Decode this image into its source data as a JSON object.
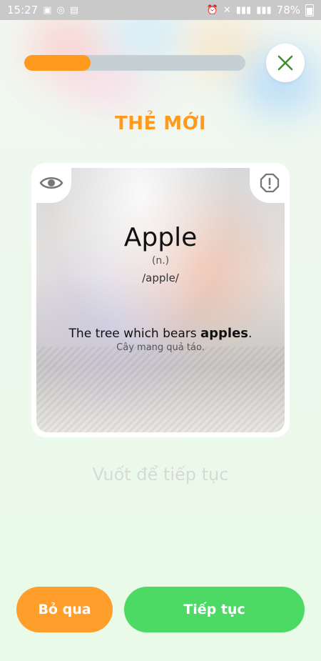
{
  "status_bar": {
    "time": "15:27",
    "battery": "78%"
  },
  "progress": {
    "fraction": 0.3
  },
  "heading": "THẺ MỚI",
  "card": {
    "word": "Apple",
    "part_of_speech": "(n.)",
    "pronunciation": "/apple/",
    "example_prefix": "The tree which bears ",
    "example_highlight": "apples",
    "example_suffix": ".",
    "translation": "Cây mang quả táo."
  },
  "hint": "Vuốt để tiếp tục",
  "buttons": {
    "skip": "Bỏ qua",
    "next": "Tiếp tục"
  },
  "colors": {
    "accent_orange": "#ff9a1f",
    "accent_green": "#4cd964",
    "close_icon_green": "#3e8e2c"
  }
}
